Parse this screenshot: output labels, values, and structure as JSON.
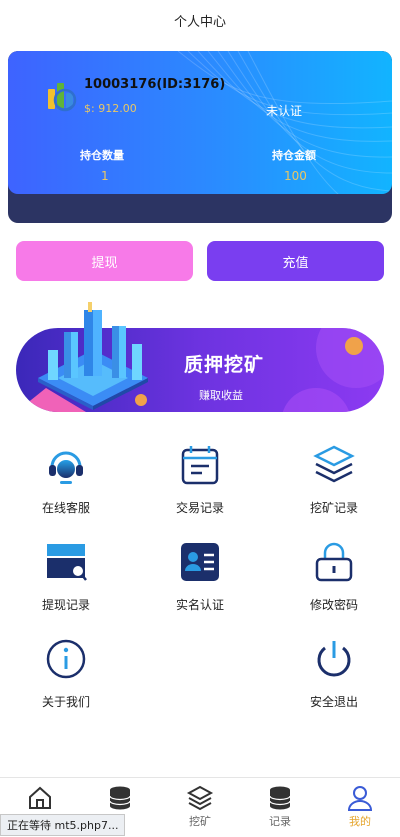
{
  "header": {
    "title": "个人中心"
  },
  "account": {
    "uid": "10003176(ID:3176)",
    "balance": "$:  912.00",
    "verify_status": "未认证",
    "position_qty_label": "持仓数量",
    "position_qty": "1",
    "position_amount_label": "持仓金额",
    "position_amount": "100"
  },
  "actions": {
    "withdraw": "提现",
    "recharge": "充值"
  },
  "banner": {
    "title": "质押挖矿",
    "subtitle": "赚取收益"
  },
  "menu": [
    {
      "label": "在线客服",
      "icon": "headset-icon"
    },
    {
      "label": "交易记录",
      "icon": "calendar-icon"
    },
    {
      "label": "挖矿记录",
      "icon": "layers-icon"
    },
    {
      "label": "提现记录",
      "icon": "card-search-icon"
    },
    {
      "label": "实名认证",
      "icon": "id-card-icon"
    },
    {
      "label": "修改密码",
      "icon": "lock-icon"
    },
    {
      "label": "关于我们",
      "icon": "info-icon"
    },
    {
      "label": "安全退出",
      "icon": "power-icon"
    }
  ],
  "tabs": [
    {
      "label": "",
      "icon": "home-icon"
    },
    {
      "label": "",
      "icon": "coins-icon"
    },
    {
      "label": "挖矿",
      "icon": "layers-icon"
    },
    {
      "label": "记录",
      "icon": "coins-icon"
    },
    {
      "label": "我的",
      "icon": "user-icon",
      "active": true
    }
  ],
  "status_bar": {
    "text": "正在等待 mt5.php7..."
  },
  "colors": {
    "accent": "#e5a52d",
    "withdraw": "#f77ae8",
    "recharge": "#7a3ef0",
    "card_blue": "#2a8cff"
  }
}
